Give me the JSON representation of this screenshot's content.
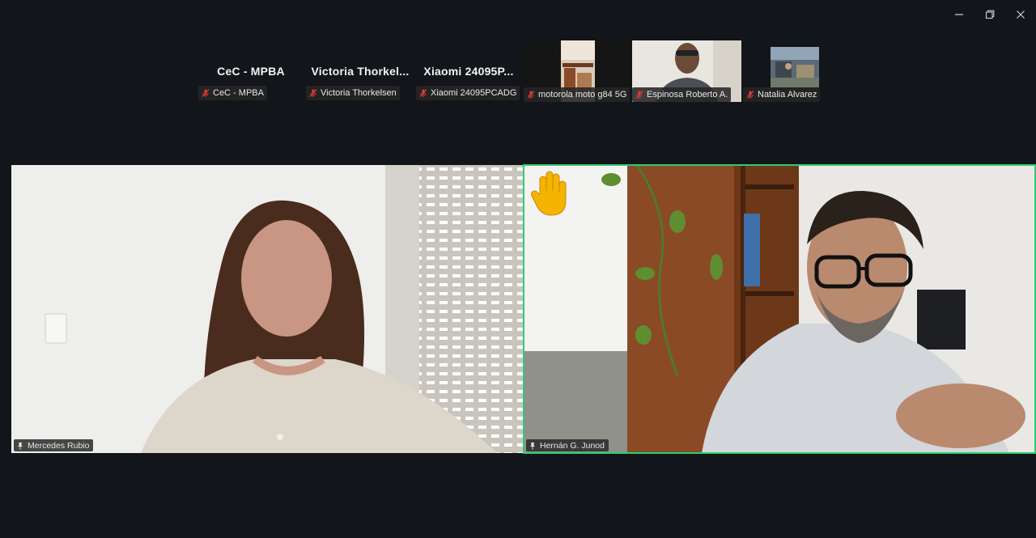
{
  "window_controls": {
    "minimize": "—",
    "restore": "❐",
    "close": "✕"
  },
  "strip": [
    {
      "big_name": "CeC - MPBA",
      "label": "CeC - MPBA",
      "muted": true,
      "has_video": false
    },
    {
      "big_name": "Victoria  Thorkel...",
      "label": "Victoria Thorkelsen",
      "muted": true,
      "has_video": false
    },
    {
      "big_name": "Xiaomi  24095P...",
      "label": "Xiaomi 24095PCADG",
      "muted": true,
      "has_video": false
    },
    {
      "label": "motorola moto g84 5G",
      "muted": true,
      "has_video": true
    },
    {
      "label": "Espinosa Roberto A.",
      "muted": true,
      "has_video": true
    },
    {
      "label": "Natalia Alvarez",
      "muted": true,
      "has_video": true
    }
  ],
  "main_tiles": [
    {
      "name": "Mercedes Rubio",
      "pinned": true,
      "raised_hand": false,
      "speaking": false
    },
    {
      "name": "Hernán G. Junod",
      "pinned": true,
      "raised_hand": true,
      "speaking": true
    }
  ],
  "colors": {
    "background": "#121519",
    "active_speaker_border": "#2ecc71",
    "muted_mic": "#e53935",
    "raised_hand": "#f4b400"
  }
}
